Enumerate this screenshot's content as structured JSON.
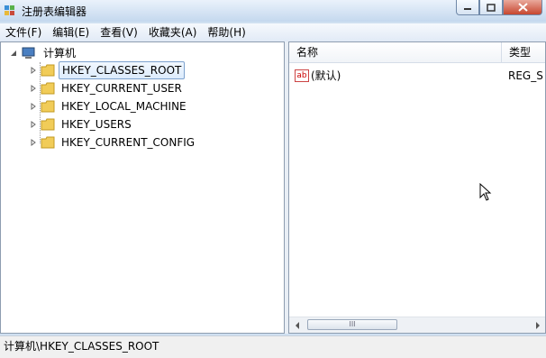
{
  "window": {
    "title": "注册表编辑器",
    "controls": {
      "minimize": "minimize-icon",
      "maximize": "maximize-icon",
      "close": "close-icon"
    }
  },
  "menu": [
    "文件(F)",
    "编辑(E)",
    "查看(V)",
    "收藏夹(A)",
    "帮助(H)"
  ],
  "tree": {
    "root": "计算机",
    "keys": [
      {
        "label": "HKEY_CLASSES_ROOT",
        "selected": true
      },
      {
        "label": "HKEY_CURRENT_USER",
        "selected": false
      },
      {
        "label": "HKEY_LOCAL_MACHINE",
        "selected": false
      },
      {
        "label": "HKEY_USERS",
        "selected": false
      },
      {
        "label": "HKEY_CURRENT_CONFIG",
        "selected": false
      }
    ]
  },
  "list": {
    "columns": {
      "name": "名称",
      "type": "类型"
    },
    "rows": [
      {
        "icon": "ab",
        "name": "(默认)",
        "type": "REG_S"
      }
    ],
    "scroll_thumb": "III"
  },
  "status": {
    "path": "计算机\\HKEY_CLASSES_ROOT"
  },
  "colors": {
    "titlebar": "#c4d8ee",
    "close": "#c7462f",
    "selection": "#dcebfc"
  }
}
